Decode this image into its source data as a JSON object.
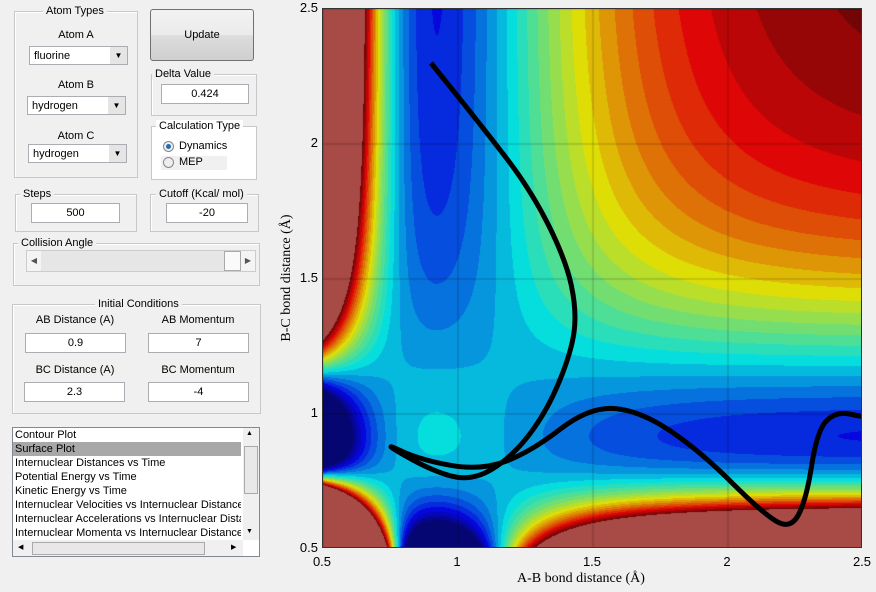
{
  "atom_types": {
    "title": "Atom Types",
    "atom_a_label": "Atom A",
    "atom_a": "fluorine",
    "atom_b_label": "Atom B",
    "atom_b": "hydrogen",
    "atom_c_label": "Atom C",
    "atom_c": "hydrogen"
  },
  "update_label": "Update",
  "delta": {
    "title": "Delta Value",
    "value": "0.424"
  },
  "calc": {
    "title": "Calculation Type",
    "options": [
      "Dynamics",
      "MEP"
    ],
    "selected": "Dynamics"
  },
  "steps": {
    "title": "Steps",
    "value": "500"
  },
  "cutoff": {
    "title": "Cutoff (Kcal/ mol)",
    "value": "-20"
  },
  "collision": {
    "title": "Collision Angle",
    "slider_fraction": 1.0
  },
  "initial": {
    "title": "Initial Conditions",
    "ab_dist_label": "AB Distance (A)",
    "ab_dist": "0.9",
    "ab_mom_label": "AB Momentum",
    "ab_mom": "7",
    "bc_dist_label": "BC Distance (A)",
    "bc_dist": "2.3",
    "bc_mom_label": "BC Momentum",
    "bc_mom": "-4"
  },
  "plot_list": {
    "items": [
      "Contour Plot",
      "Surface Plot",
      "Internuclear Distances vs Time",
      "Potential Energy vs Time",
      "Kinetic Energy vs Time",
      "Internuclear Velocities vs Internuclear Distances",
      "Internuclear Accelerations vs Internuclear Distances",
      "Internuclear Momenta vs Internuclear Distances"
    ],
    "selected": "Surface Plot"
  },
  "chart_data": {
    "type": "heatmap",
    "xlabel": "A-B bond distance (Å)",
    "ylabel": "B-C bond distance (Å)",
    "xlim": [
      0.5,
      2.5
    ],
    "ylim": [
      0.5,
      2.5
    ],
    "xticks": [
      "0.5",
      "1",
      "1.5",
      "2",
      "2.5"
    ],
    "yticks": [
      "0.5",
      "1",
      "1.5",
      "2",
      "2.5"
    ],
    "colormap": "jet",
    "trajectory_color": "#000000",
    "trajectory": {
      "x": [
        0.9,
        1.085,
        1.27,
        1.4,
        1.44,
        1.42,
        1.33,
        1.2,
        1.05,
        0.9,
        0.71,
        0.86,
        1.085,
        1.27,
        1.49,
        1.68,
        1.9,
        2.12,
        2.23,
        2.29,
        2.33,
        2.4,
        2.5
      ],
      "y": [
        2.3,
        2.07,
        1.83,
        1.57,
        1.38,
        1.23,
        1.01,
        0.84,
        0.75,
        0.79,
        0.9,
        0.83,
        0.79,
        0.86,
        1.03,
        1.01,
        0.86,
        0.64,
        0.57,
        0.68,
        0.94,
        1.01,
        0.99
      ]
    }
  }
}
